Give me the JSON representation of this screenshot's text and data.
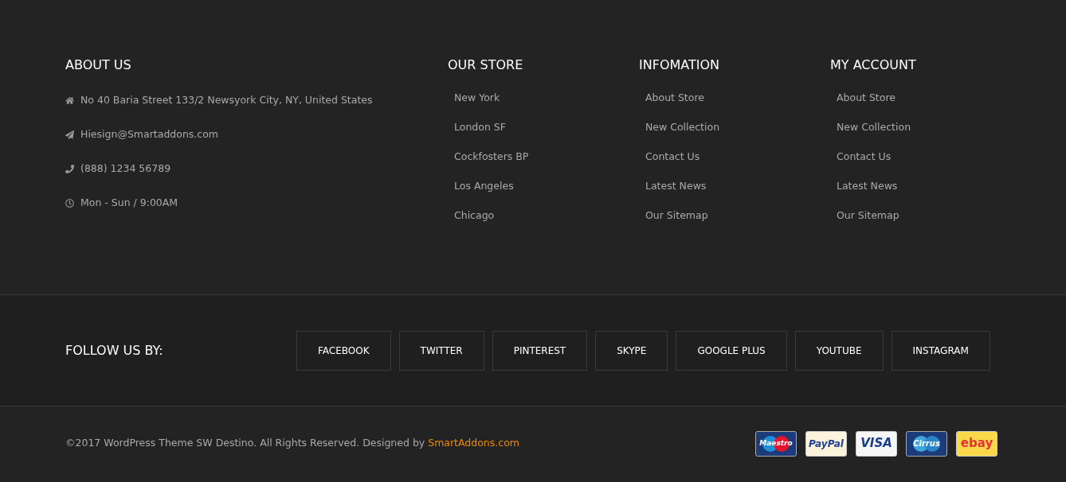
{
  "about": {
    "title": "ABOUT US",
    "items": [
      {
        "kind": "address",
        "text": "No 40 Baria Street 133/2 Newsyork City, NY, United States"
      },
      {
        "kind": "email",
        "text": "Hiesign@Smartaddons.com"
      },
      {
        "kind": "phone",
        "text": "(888) 1234 56789"
      },
      {
        "kind": "hours",
        "text": "Mon - Sun / 9:00AM"
      }
    ]
  },
  "columns": [
    {
      "title": "OUR STORE",
      "links": [
        "New York",
        "London SF",
        "Cockfosters BP",
        "Los Angeles",
        "Chicago"
      ]
    },
    {
      "title": "INFOMATION",
      "links": [
        "About Store",
        "New Collection",
        "Contact Us",
        "Latest News",
        "Our Sitemap"
      ]
    },
    {
      "title": "MY ACCOUNT",
      "links": [
        "About Store",
        "New Collection",
        "Contact Us",
        "Latest News",
        "Our Sitemap"
      ]
    }
  ],
  "follow": {
    "title": "FOLLOW US BY:",
    "buttons": [
      "FACEBOOK",
      "TWITTER",
      "PINTEREST",
      "SKYPE",
      "GOOGLE PLUS",
      "YOUTUBE",
      "INSTAGRAM"
    ]
  },
  "copyright": {
    "text": "©2017 WordPress Theme SW Destino. All Rights Reserved. Designed by ",
    "link": "SmartAddons.com"
  },
  "payments": [
    {
      "kind": "maestro",
      "label": "Maestro"
    },
    {
      "kind": "paypal",
      "label": "PayPal"
    },
    {
      "kind": "visa",
      "label": "VISA"
    },
    {
      "kind": "cirrus",
      "label": "Cirrus"
    },
    {
      "kind": "ebay",
      "label": "ebay"
    }
  ]
}
